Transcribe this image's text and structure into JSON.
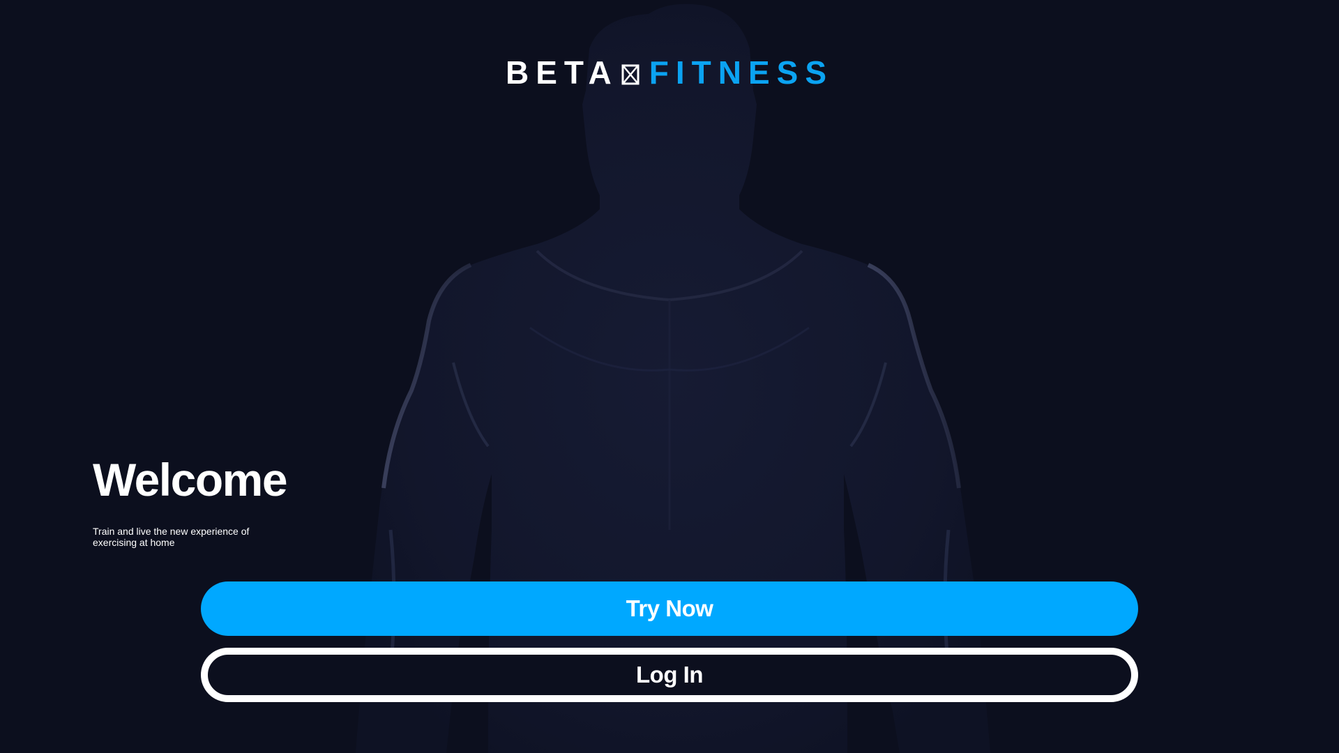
{
  "logo": {
    "left": "BETA",
    "right": "FITNESS",
    "mark_icon": "x-box-icon"
  },
  "hero": {
    "image": "muscular-man-silhouette"
  },
  "welcome": {
    "title": "Welcome",
    "subtitle": "Train and live the new experience of exercising at home"
  },
  "actions": {
    "try_now": "Try Now",
    "log_in": "Log In"
  },
  "colors": {
    "background": "#0c0f1e",
    "accent": "#00a8ff",
    "logo_accent": "#0ba3f2",
    "text": "#ffffff"
  }
}
